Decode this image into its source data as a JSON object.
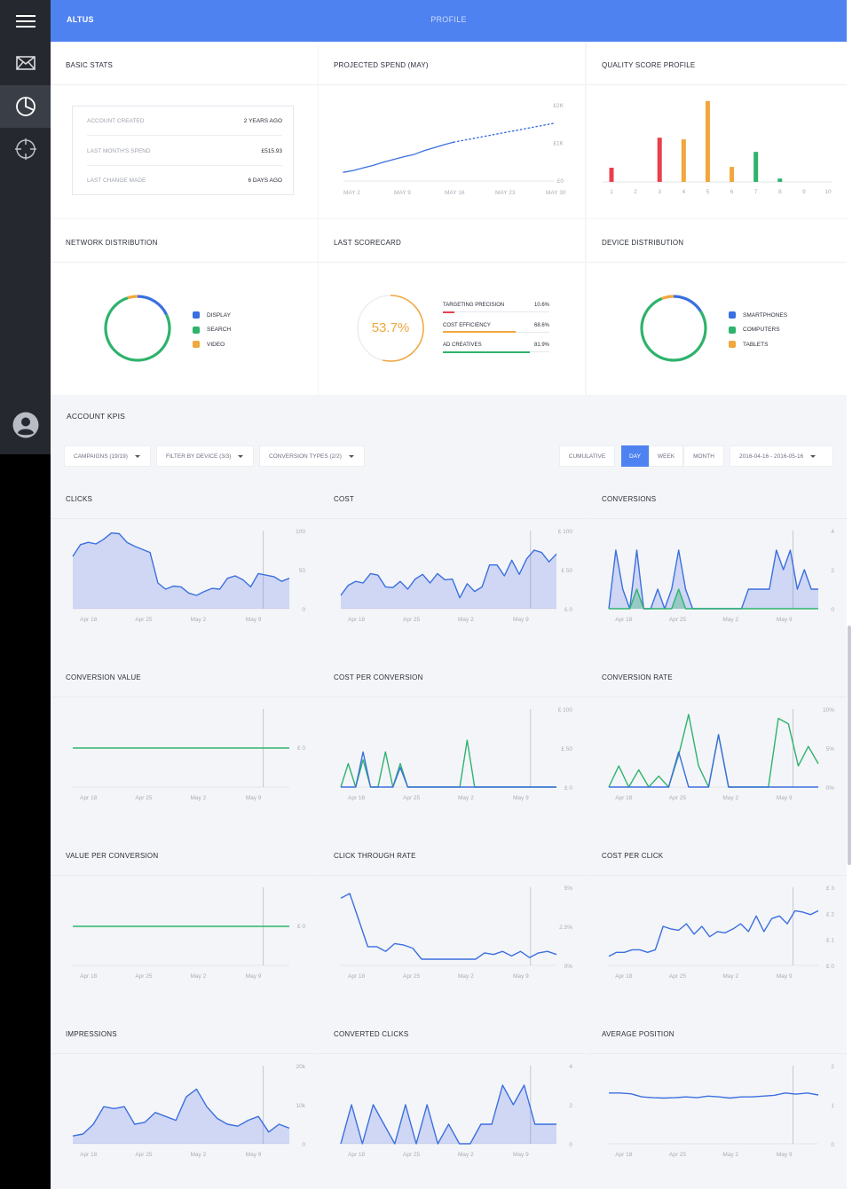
{
  "header": {
    "brand": "ALTUS",
    "title": "PROFILE"
  },
  "sidebar": {
    "items": [
      {
        "name": "menu",
        "icon": "hamburger-icon"
      },
      {
        "name": "mail",
        "icon": "mail-icon"
      },
      {
        "name": "dashboard",
        "icon": "pie-chart-icon"
      },
      {
        "name": "targeting",
        "icon": "crosshair-icon"
      },
      {
        "name": "account",
        "icon": "user-icon"
      }
    ]
  },
  "basic_stats": {
    "title": "BASIC STATS",
    "rows": [
      {
        "label": "ACCOUNT CREATED",
        "value": "2 YEARS AGO"
      },
      {
        "label": "LAST MONTH'S SPEND",
        "value": "£515.93"
      },
      {
        "label": "LAST CHANGE MADE",
        "value": "6 DAYS AGO"
      }
    ]
  },
  "projected_spend": {
    "title": "PROJECTED SPEND (MAY)"
  },
  "quality_score": {
    "title": "QUALITY SCORE PROFILE"
  },
  "network_distribution": {
    "title": "NETWORK DISTRIBUTION",
    "legend": [
      {
        "label": "DISPLAY",
        "color": "#3b6fe0"
      },
      {
        "label": "SEARCH",
        "color": "#2eb36c"
      },
      {
        "label": "VIDEO",
        "color": "#f0a73d"
      }
    ]
  },
  "last_scorecard": {
    "title": "LAST SCORECARD",
    "score": "53.7%",
    "score_fraction": 0.537,
    "items": [
      {
        "label": "TARGETING PRECISION",
        "value": "10.6%",
        "fraction": 0.106,
        "color": "#e8404b"
      },
      {
        "label": "COST EFFICIENCY",
        "value": "68.6%",
        "fraction": 0.686,
        "color": "#f0a73d"
      },
      {
        "label": "AD CREATIVES",
        "value": "81.9%",
        "fraction": 0.819,
        "color": "#2eb36c"
      }
    ]
  },
  "device_distribution": {
    "title": "DEVICE DISTRIBUTION",
    "legend": [
      {
        "label": "SMARTPHONES",
        "color": "#3b6fe0"
      },
      {
        "label": "COMPUTERS",
        "color": "#2eb36c"
      },
      {
        "label": "TABLETS",
        "color": "#f0a73d"
      }
    ]
  },
  "kpis": {
    "title": "ACCOUNT KPIS",
    "filters": [
      {
        "label": "CAMPAIGNS (19/19)"
      },
      {
        "label": "FILTER BY DEVICE (3/3)"
      },
      {
        "label": "CONVERSION TYPES (2/2)"
      }
    ],
    "modes": [
      "CUMULATIVE",
      "DAY",
      "WEEK",
      "MONTH"
    ],
    "active_mode": "DAY",
    "date_range": "2016-04-16 - 2016-05-16"
  },
  "chart_data": [
    {
      "id": "projected",
      "type": "line",
      "categories": [
        "MAY 2",
        "MAY 9",
        "MAY 16",
        "MAY 23",
        "MAY 30"
      ],
      "y_ticks": [
        "£2K",
        "£1K",
        "£0"
      ],
      "ylim": [
        0,
        2000
      ],
      "series": [
        {
          "values": [
            230,
            280,
            350,
            420,
            500,
            570,
            640,
            700,
            800,
            880,
            960,
            1030
          ],
          "style": "solid",
          "color": "#3b6fe0"
        },
        {
          "values": [
            1030,
            1080,
            1130,
            1180,
            1230,
            1280,
            1330,
            1380,
            1430,
            1480,
            1530
          ],
          "style": "dotted",
          "color": "#3b6fe0"
        }
      ]
    },
    {
      "id": "quality",
      "type": "bar",
      "categories": [
        "1",
        "2",
        "3",
        "4",
        "5",
        "6",
        "7",
        "8",
        "9",
        "10"
      ],
      "ylim": [
        0,
        100
      ],
      "values": [
        17,
        0,
        53,
        51,
        97,
        18,
        36,
        4,
        0,
        0
      ],
      "colors": [
        "#e8404b",
        "#e8404b",
        "#e8404b",
        "#f0a73d",
        "#f0a73d",
        "#f0a73d",
        "#2eb36c",
        "#2eb36c",
        "#2eb36c",
        "#2eb36c"
      ]
    },
    {
      "id": "network",
      "type": "pie",
      "slices": [
        {
          "label": "DISPLAY",
          "value": 18,
          "color": "#3b6fe0"
        },
        {
          "label": "SEARCH",
          "value": 77,
          "color": "#2eb36c"
        },
        {
          "label": "VIDEO",
          "value": 5,
          "color": "#f0a73d"
        }
      ]
    },
    {
      "id": "device",
      "type": "pie",
      "slices": [
        {
          "label": "SMARTPHONES",
          "value": 16,
          "color": "#3b6fe0"
        },
        {
          "label": "COMPUTERS",
          "value": 78,
          "color": "#2eb36c"
        },
        {
          "label": "TABLETS",
          "value": 6,
          "color": "#f0a73d"
        }
      ]
    },
    {
      "id": "clicks",
      "title": "CLICKS",
      "type": "area",
      "x_ticks": [
        "Apr 18",
        "Apr 25",
        "May 2",
        "May 9"
      ],
      "y_ticks": [
        "100",
        "50",
        "0"
      ],
      "ylim": [
        0,
        100
      ],
      "series": [
        {
          "values": [
            67,
            82,
            85,
            83,
            89,
            97,
            96,
            85,
            80,
            76,
            72,
            33,
            25,
            29,
            28,
            20,
            17,
            22,
            26,
            25,
            39,
            42,
            37,
            28,
            45,
            43,
            41,
            35,
            39
          ],
          "color": "#3b6fe0"
        }
      ]
    },
    {
      "id": "cost",
      "title": "COST",
      "type": "area",
      "x_ticks": [
        "Apr 18",
        "Apr 25",
        "May 2",
        "May 9"
      ],
      "y_ticks": [
        "£ 100",
        "£ 50",
        "£ 0"
      ],
      "ylim": [
        0,
        100
      ],
      "series": [
        {
          "values": [
            17,
            30,
            35,
            33,
            45,
            43,
            28,
            27,
            35,
            25,
            38,
            44,
            33,
            45,
            37,
            38,
            14,
            32,
            22,
            28,
            56,
            56,
            42,
            62,
            44,
            64,
            75,
            72,
            60,
            70
          ],
          "color": "#3b6fe0"
        }
      ]
    },
    {
      "id": "conversions",
      "title": "CONVERSIONS",
      "type": "area",
      "x_ticks": [
        "Apr 18",
        "Apr 25",
        "May 2",
        "May 9"
      ],
      "y_ticks": [
        "4",
        "2",
        "0"
      ],
      "ylim": [
        0,
        4
      ],
      "series": [
        {
          "values": [
            0,
            3,
            1,
            0,
            3,
            0,
            0,
            1,
            0,
            1,
            3,
            1,
            0,
            0,
            0,
            0,
            0,
            0,
            0,
            0,
            1,
            1,
            1,
            1,
            3,
            2,
            3,
            1,
            2,
            1,
            1
          ],
          "color": "#3b6fe0"
        },
        {
          "values": [
            0,
            0,
            0,
            0,
            1,
            0,
            0,
            0,
            0,
            0,
            1,
            0,
            0,
            0,
            0,
            0,
            0,
            0,
            0,
            0,
            0,
            0,
            0,
            0,
            0,
            0,
            0,
            0,
            0,
            0,
            0
          ],
          "color": "#2eb36c"
        }
      ]
    },
    {
      "id": "conv_value",
      "title": "CONVERSION VALUE",
      "type": "line",
      "x_ticks": [
        "Apr 18",
        "Apr 25",
        "May 2",
        "May 9"
      ],
      "y_ticks": [
        "£ 0"
      ],
      "ylim": [
        -1,
        1
      ],
      "series": [
        {
          "values": [
            0,
            0,
            0,
            0,
            0,
            0,
            0,
            0,
            0,
            0
          ],
          "color": "#2eb36c"
        }
      ]
    },
    {
      "id": "cost_per_conv",
      "title": "COST PER CONVERSION",
      "type": "line",
      "x_ticks": [
        "Apr 18",
        "Apr 25",
        "May 2",
        "May 9"
      ],
      "y_ticks": [
        "£ 100",
        "£ 50",
        "£ 0"
      ],
      "ylim": [
        0,
        100
      ],
      "series": [
        {
          "values": [
            0,
            30,
            0,
            35,
            0,
            0,
            45,
            0,
            30,
            0,
            0,
            0,
            0,
            0,
            0,
            0,
            0,
            60,
            0,
            0,
            0,
            0,
            0,
            0,
            0,
            0,
            0,
            0,
            0,
            0
          ],
          "color": "#2eb36c"
        },
        {
          "values": [
            0,
            0,
            0,
            45,
            0,
            0,
            0,
            0,
            25,
            0,
            0,
            0,
            0,
            0,
            0,
            0,
            0,
            0,
            0,
            0,
            0,
            0,
            0,
            0,
            0,
            0,
            0,
            0,
            0,
            0
          ],
          "color": "#3b6fe0"
        }
      ]
    },
    {
      "id": "conv_rate",
      "title": "CONVERSION RATE",
      "type": "line",
      "x_ticks": [
        "Apr 18",
        "Apr 25",
        "May 2",
        "May 9"
      ],
      "y_ticks": [
        "10%",
        "5%",
        "0%"
      ],
      "ylim": [
        0,
        10
      ],
      "series": [
        {
          "values": [
            0,
            2.7,
            0,
            2.2,
            0,
            1.4,
            0,
            4.1,
            9.3,
            2.7,
            0,
            6.7,
            0,
            0,
            0,
            0,
            0,
            8.8,
            8.1,
            2.7,
            5.2,
            3.0
          ],
          "color": "#2eb36c"
        },
        {
          "values": [
            0,
            0,
            0,
            0,
            0,
            0,
            0,
            4.5,
            0,
            0,
            0,
            6.7,
            0,
            0,
            0,
            0,
            0,
            0,
            0,
            0,
            0,
            0
          ],
          "color": "#3b6fe0"
        }
      ]
    },
    {
      "id": "value_per_conv",
      "title": "VALUE PER CONVERSION",
      "type": "line",
      "x_ticks": [
        "Apr 18",
        "Apr 25",
        "May 2",
        "May 9"
      ],
      "y_ticks": [
        "£ 0"
      ],
      "ylim": [
        -1,
        1
      ],
      "series": [
        {
          "values": [
            0,
            0,
            0,
            0,
            0,
            0,
            0,
            0,
            0,
            0
          ],
          "color": "#2eb36c"
        }
      ]
    },
    {
      "id": "ctr",
      "title": "CLICK THROUGH RATE",
      "type": "line",
      "x_ticks": [
        "Apr 18",
        "Apr 25",
        "May 2",
        "May 9"
      ],
      "y_ticks": [
        "5%",
        "2.5%",
        "0%"
      ],
      "ylim": [
        0,
        5
      ],
      "series": [
        {
          "values": [
            4.3,
            4.6,
            2.9,
            1.2,
            1.2,
            0.9,
            1.4,
            1.3,
            1.1,
            0.4,
            0.4,
            0.4,
            0.4,
            0.4,
            0.4,
            0.4,
            0.8,
            0.7,
            0.9,
            0.6,
            0.9,
            0.5,
            0.8,
            0.9,
            0.7
          ],
          "color": "#3b6fe0"
        }
      ]
    },
    {
      "id": "cpc",
      "title": "COST PER CLICK",
      "type": "line",
      "x_ticks": [
        "Apr 18",
        "Apr 25",
        "May 2",
        "May 9"
      ],
      "y_ticks": [
        "£ 3",
        "£ 2",
        "£ 1",
        "£ 0"
      ],
      "ylim": [
        0,
        3
      ],
      "series": [
        {
          "values": [
            0.35,
            0.5,
            0.5,
            0.6,
            0.6,
            0.5,
            0.6,
            1.5,
            1.4,
            1.35,
            1.6,
            1.2,
            1.5,
            1.1,
            1.3,
            1.25,
            1.4,
            1.6,
            1.3,
            1.9,
            1.3,
            1.8,
            1.9,
            1.6,
            2.1,
            2.05,
            1.95,
            2.1
          ],
          "color": "#3b6fe0"
        }
      ]
    },
    {
      "id": "impressions",
      "title": "IMPRESSIONS",
      "type": "area",
      "x_ticks": [
        "Apr 18",
        "Apr 25",
        "May 2",
        "May 9"
      ],
      "y_ticks": [
        "20k",
        "10k",
        "0"
      ],
      "ylim": [
        0,
        20000
      ],
      "series": [
        {
          "values": [
            2000,
            2500,
            5000,
            9500,
            9000,
            9500,
            5000,
            5500,
            8000,
            7000,
            6000,
            12000,
            14000,
            9500,
            6500,
            5000,
            4500,
            6000,
            7000,
            3000,
            5000,
            4000
          ],
          "color": "#3b6fe0"
        }
      ]
    },
    {
      "id": "converted_clicks",
      "title": "CONVERTED CLICKS",
      "type": "area",
      "x_ticks": [
        "Apr 18",
        "Apr 25",
        "May 2",
        "May 9"
      ],
      "y_ticks": [
        "4",
        "2",
        "0"
      ],
      "ylim": [
        0,
        4
      ],
      "series": [
        {
          "values": [
            0,
            2,
            0,
            2,
            1,
            0,
            2,
            0,
            2,
            0,
            1,
            0,
            0,
            1,
            1,
            3,
            2,
            3,
            1,
            1,
            1
          ],
          "color": "#3b6fe0"
        }
      ]
    },
    {
      "id": "avg_position",
      "title": "AVERAGE POSITION",
      "type": "line",
      "x_ticks": [
        "Apr 18",
        "Apr 25",
        "May 2",
        "May 9"
      ],
      "y_ticks": [
        "2",
        "1",
        "0"
      ],
      "ylim": [
        0,
        2
      ],
      "series": [
        {
          "values": [
            1.3,
            1.3,
            1.28,
            1.2,
            1.18,
            1.17,
            1.18,
            1.2,
            1.18,
            1.22,
            1.2,
            1.17,
            1.2,
            1.2,
            1.22,
            1.24,
            1.3,
            1.27,
            1.3,
            1.25
          ],
          "color": "#3b6fe0"
        }
      ]
    }
  ]
}
